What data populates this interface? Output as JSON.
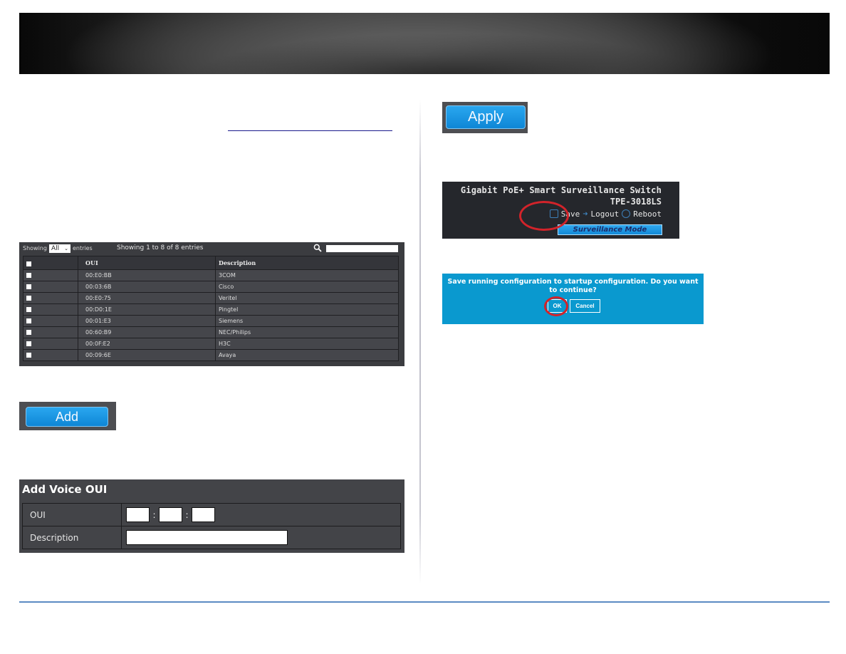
{
  "oui_table": {
    "showing_label": "Showing",
    "entries_select": "All",
    "entries_label": "entries",
    "info": "Showing 1 to 8 of 8 entries",
    "search_placeholder": "",
    "columns": [
      "OUI",
      "Description"
    ],
    "rows": [
      {
        "oui": "00:E0:BB",
        "description": "3COM"
      },
      {
        "oui": "00:03:6B",
        "description": "Cisco"
      },
      {
        "oui": "00:E0:75",
        "description": "Veritel"
      },
      {
        "oui": "00:D0:1E",
        "description": "Pingtel"
      },
      {
        "oui": "00:01:E3",
        "description": "Siemens"
      },
      {
        "oui": "00:60:B9",
        "description": "NEC/Philips"
      },
      {
        "oui": "00:0F:E2",
        "description": "H3C"
      },
      {
        "oui": "00:09:6E",
        "description": "Avaya"
      }
    ]
  },
  "buttons": {
    "add": "Add",
    "apply": "Apply"
  },
  "add_voice_oui": {
    "title": "Add Voice OUI",
    "oui_label": "OUI",
    "oui_separator": ":",
    "oui_values": [
      "",
      "",
      ""
    ],
    "description_label": "Description",
    "description_value": ""
  },
  "device_header": {
    "product_name": "Gigabit PoE+ Smart Surveillance Switch",
    "model": "TPE-3018LS",
    "save": "Save",
    "logout": "Logout",
    "reboot": "Reboot",
    "mode": "Surveillance Mode"
  },
  "confirm_dialog": {
    "message": "Save running configuration to startup configuration. Do you want to continue?",
    "ok": "OK",
    "cancel": "Cancel"
  },
  "colors": {
    "accent_blue": "#0e86d6",
    "dialog_blue": "#0a99cf",
    "highlight_red": "#d2232a",
    "footer_rule": "#5b8bc3",
    "link_underline": "#1a1a8c"
  }
}
